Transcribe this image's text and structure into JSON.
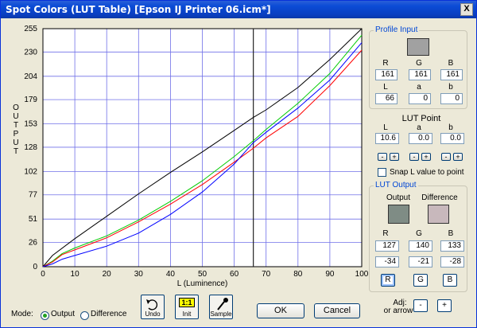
{
  "window": {
    "title": "Spot Colors (LUT Table) [Epson IJ Printer 06.icm*]",
    "close_label": "X"
  },
  "chart_data": {
    "type": "line",
    "title": "",
    "xlabel": "L (Luminence)",
    "ylabel": "OUTPUT",
    "xlim": [
      0,
      100
    ],
    "ylim": [
      0,
      255
    ],
    "x_ticks": [
      0,
      10,
      20,
      30,
      40,
      50,
      60,
      70,
      80,
      90,
      100
    ],
    "y_ticks": [
      0,
      26,
      51,
      77,
      102,
      128,
      153,
      179,
      204,
      230,
      255
    ],
    "grid": true,
    "cursor_x": 66,
    "series": [
      {
        "color": "#000000",
        "x": [
          0,
          3,
          10,
          20,
          30,
          40,
          50,
          60,
          66,
          70,
          80,
          90,
          100
        ],
        "values": [
          0,
          12,
          30,
          54,
          78,
          101,
          123,
          146,
          160,
          168,
          192,
          222,
          255
        ]
      },
      {
        "color": "#00cc00",
        "x": [
          0,
          3,
          6,
          10,
          20,
          30,
          40,
          50,
          60,
          66,
          70,
          80,
          90,
          100
        ],
        "values": [
          0,
          6,
          14,
          20,
          33,
          50,
          70,
          92,
          118,
          135,
          147,
          175,
          207,
          248
        ]
      },
      {
        "color": "#ff0000",
        "x": [
          0,
          3,
          6,
          10,
          20,
          30,
          40,
          50,
          60,
          66,
          70,
          80,
          90,
          100
        ],
        "values": [
          0,
          5,
          13,
          18,
          31,
          48,
          67,
          88,
          112,
          127,
          138,
          161,
          194,
          232
        ]
      },
      {
        "color": "#0000ff",
        "x": [
          0,
          3,
          6,
          10,
          20,
          30,
          40,
          50,
          60,
          66,
          70,
          80,
          90,
          100
        ],
        "values": [
          0,
          3,
          8,
          12,
          22,
          36,
          56,
          80,
          110,
          133,
          144,
          170,
          200,
          240
        ]
      }
    ]
  },
  "mode": {
    "label": "Mode:",
    "output_label": "Output",
    "difference_label": "Difference",
    "selected": "Output"
  },
  "toolbar": {
    "undo_label": "Undo",
    "init_label": "Init",
    "init_icon_text": "1:1",
    "sample_label": "Sample"
  },
  "buttons": {
    "ok_label": "OK",
    "cancel_label": "Cancel"
  },
  "profile_input": {
    "title": "Profile Input",
    "swatch_color": "#a1a1a1",
    "labels": [
      "R",
      "G",
      "B"
    ],
    "rgb": [
      "161",
      "161",
      "161"
    ],
    "lab_labels": [
      "L",
      "a",
      "b"
    ],
    "lab": [
      "66",
      "0",
      "0"
    ]
  },
  "lut_point": {
    "title": "LUT Point",
    "labels": [
      "L",
      "a",
      "b"
    ],
    "values": [
      "10.6",
      "0.0",
      "0.0"
    ],
    "minus": "-",
    "plus": "+",
    "snap_label": "Snap L value to point"
  },
  "lut_output": {
    "title": "LUT Output",
    "output_label": "Output",
    "difference_label": "Difference",
    "output_color": "#7f8c85",
    "difference_color": "#c8b8bc",
    "labels": [
      "R",
      "G",
      "B"
    ],
    "rgb": [
      "127",
      "140",
      "133"
    ],
    "diff": [
      "-34",
      "-21",
      "-28"
    ],
    "channel_buttons": [
      "R",
      "G",
      "B"
    ],
    "adj_label": "Adj:",
    "adj_sub": "or arrow",
    "minus": "-",
    "plus": "+"
  }
}
